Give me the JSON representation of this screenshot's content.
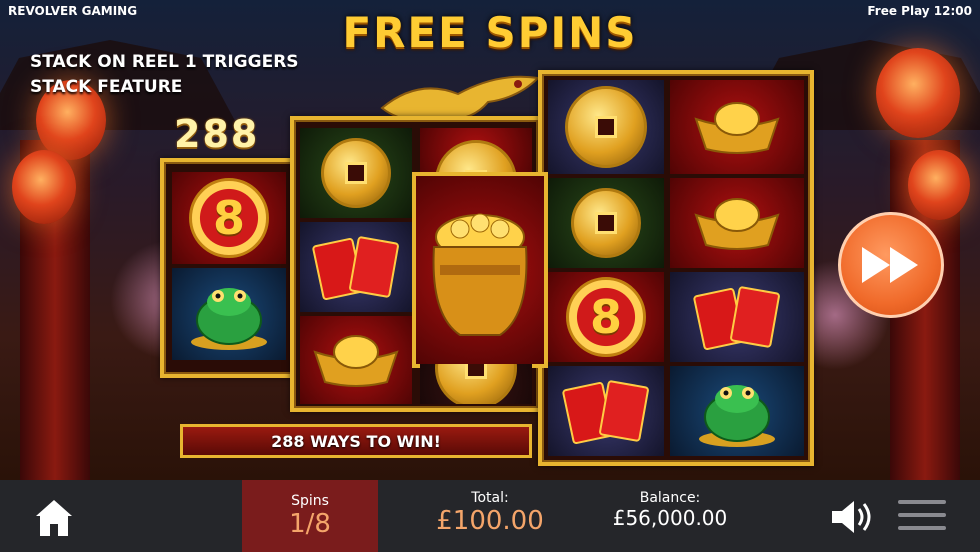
{
  "header": {
    "brand": "REVOLVER GAMING",
    "status": "Free Play 12:00",
    "title": "FREE SPINS"
  },
  "feature": {
    "message_line1": "STACK ON REEL 1 TRIGGERS",
    "message_line2": "STACK FEATURE",
    "ways_count": "288",
    "ways_banner": "288 WAYS TO WIN!"
  },
  "reels": [
    [
      "gold-8-coin",
      "jade-frog"
    ],
    [
      "copper-coin",
      "red-envelopes",
      "gold-ingot"
    ],
    [
      "gold-coin",
      "pot-of-gold",
      "copper-coin"
    ],
    [
      "gold-coin",
      "copper-coin",
      "gold-8-coin",
      "red-envelopes"
    ],
    [
      "gold-ingot",
      "gold-ingot",
      "red-envelopes",
      "jade-frog"
    ]
  ],
  "controls": {
    "spins_label": "Spins",
    "spins_value": "1/8",
    "total_label": "Total:",
    "total_value": "£100.00",
    "balance_label": "Balance:",
    "balance_value": "£56,000.00"
  },
  "icons": {
    "home": "home-icon",
    "sound": "speaker-icon",
    "menu": "hamburger-menu-icon",
    "fast_forward": "fast-forward-icon"
  },
  "colors": {
    "gold": "#e8b530",
    "title": "#ffcc33",
    "accent_orange": "#f06a2a",
    "spins_panel": "#7a1c1c",
    "bottom_bar": "#25262a",
    "value_orange": "#f4a56a"
  }
}
